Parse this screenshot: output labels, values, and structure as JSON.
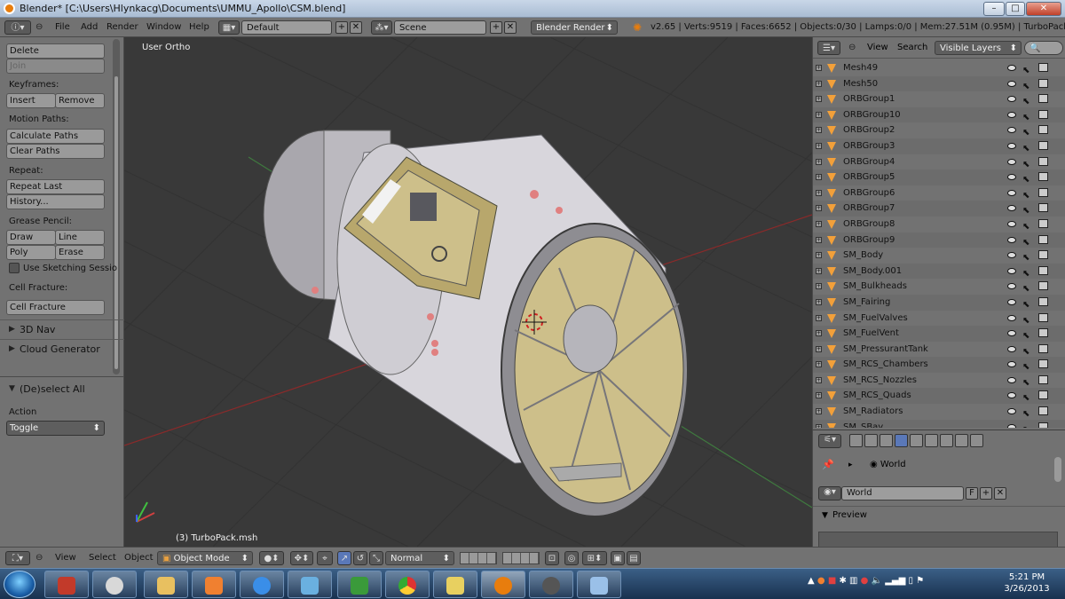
{
  "window": {
    "title": "Blender* [C:\\Users\\Hlynkacg\\Documents\\UMMU_Apollo\\CSM.blend]",
    "min_label": "–",
    "max_label": "□",
    "close_label": "✕"
  },
  "header": {
    "menu": [
      "File",
      "Add",
      "Render",
      "Window",
      "Help"
    ],
    "layout": "Default",
    "scene": "Scene",
    "engine": "Blender Render",
    "stats": "v2.65 | Verts:9519 | Faces:6652 | Objects:0/30 | Lamps:0/0 | Mem:27.51M (0.95M) | TurboPack.msh",
    "add_label": "+",
    "remove_label": "✕"
  },
  "toolshelf": {
    "delete": "Delete",
    "join": "Join",
    "keyframes_label": "Keyframes:",
    "insert": "Insert",
    "remove": "Remove",
    "motion_paths_label": "Motion Paths:",
    "calculate_paths": "Calculate Paths",
    "clear_paths": "Clear Paths",
    "repeat_label": "Repeat:",
    "repeat_last": "Repeat Last",
    "history": "History...",
    "grease_pencil_label": "Grease Pencil:",
    "draw": "Draw",
    "line": "Line",
    "poly": "Poly",
    "erase": "Erase",
    "use_sketching": "Use Sketching Sessio",
    "cell_fracture_label": "Cell Fracture:",
    "cell_fracture": "Cell Fracture",
    "nav_3d": "3D Nav",
    "cloud_generator": "Cloud Generator",
    "deselect_all": "(De)select All",
    "action_label": "Action",
    "action_value": "Toggle"
  },
  "viewport": {
    "view_label": "User Ortho",
    "object_label": "(3) TurboPack.msh"
  },
  "outliner": {
    "view": "View",
    "search": "Search",
    "filter": "Visible Layers",
    "items": [
      "Mesh49",
      "Mesh50",
      "ORBGroup1",
      "ORBGroup10",
      "ORBGroup2",
      "ORBGroup3",
      "ORBGroup4",
      "ORBGroup5",
      "ORBGroup6",
      "ORBGroup7",
      "ORBGroup8",
      "ORBGroup9",
      "SM_Body",
      "SM_Body.001",
      "SM_Bulkheads",
      "SM_Fairing",
      "SM_FuelValves",
      "SM_FuelVent",
      "SM_PressurantTank",
      "SM_RCS_Chambers",
      "SM_RCS_Nozzles",
      "SM_RCS_Quads",
      "SM_Radiators",
      "SM_SBay"
    ]
  },
  "properties": {
    "context": "World",
    "world_name": "World",
    "fake_user": "F",
    "preview_label": "Preview"
  },
  "bottombar": {
    "view": "View",
    "select": "Select",
    "object": "Object",
    "mode": "Object Mode",
    "pivot": "Normal"
  },
  "taskbar": {
    "time": "5:21 PM",
    "date": "3/26/2013"
  },
  "colors": {
    "panel": "#727272",
    "viewport": "#393939",
    "hull": "#d8d6dc",
    "gold": "#cdbf8a",
    "accent": "#f2a03a"
  }
}
